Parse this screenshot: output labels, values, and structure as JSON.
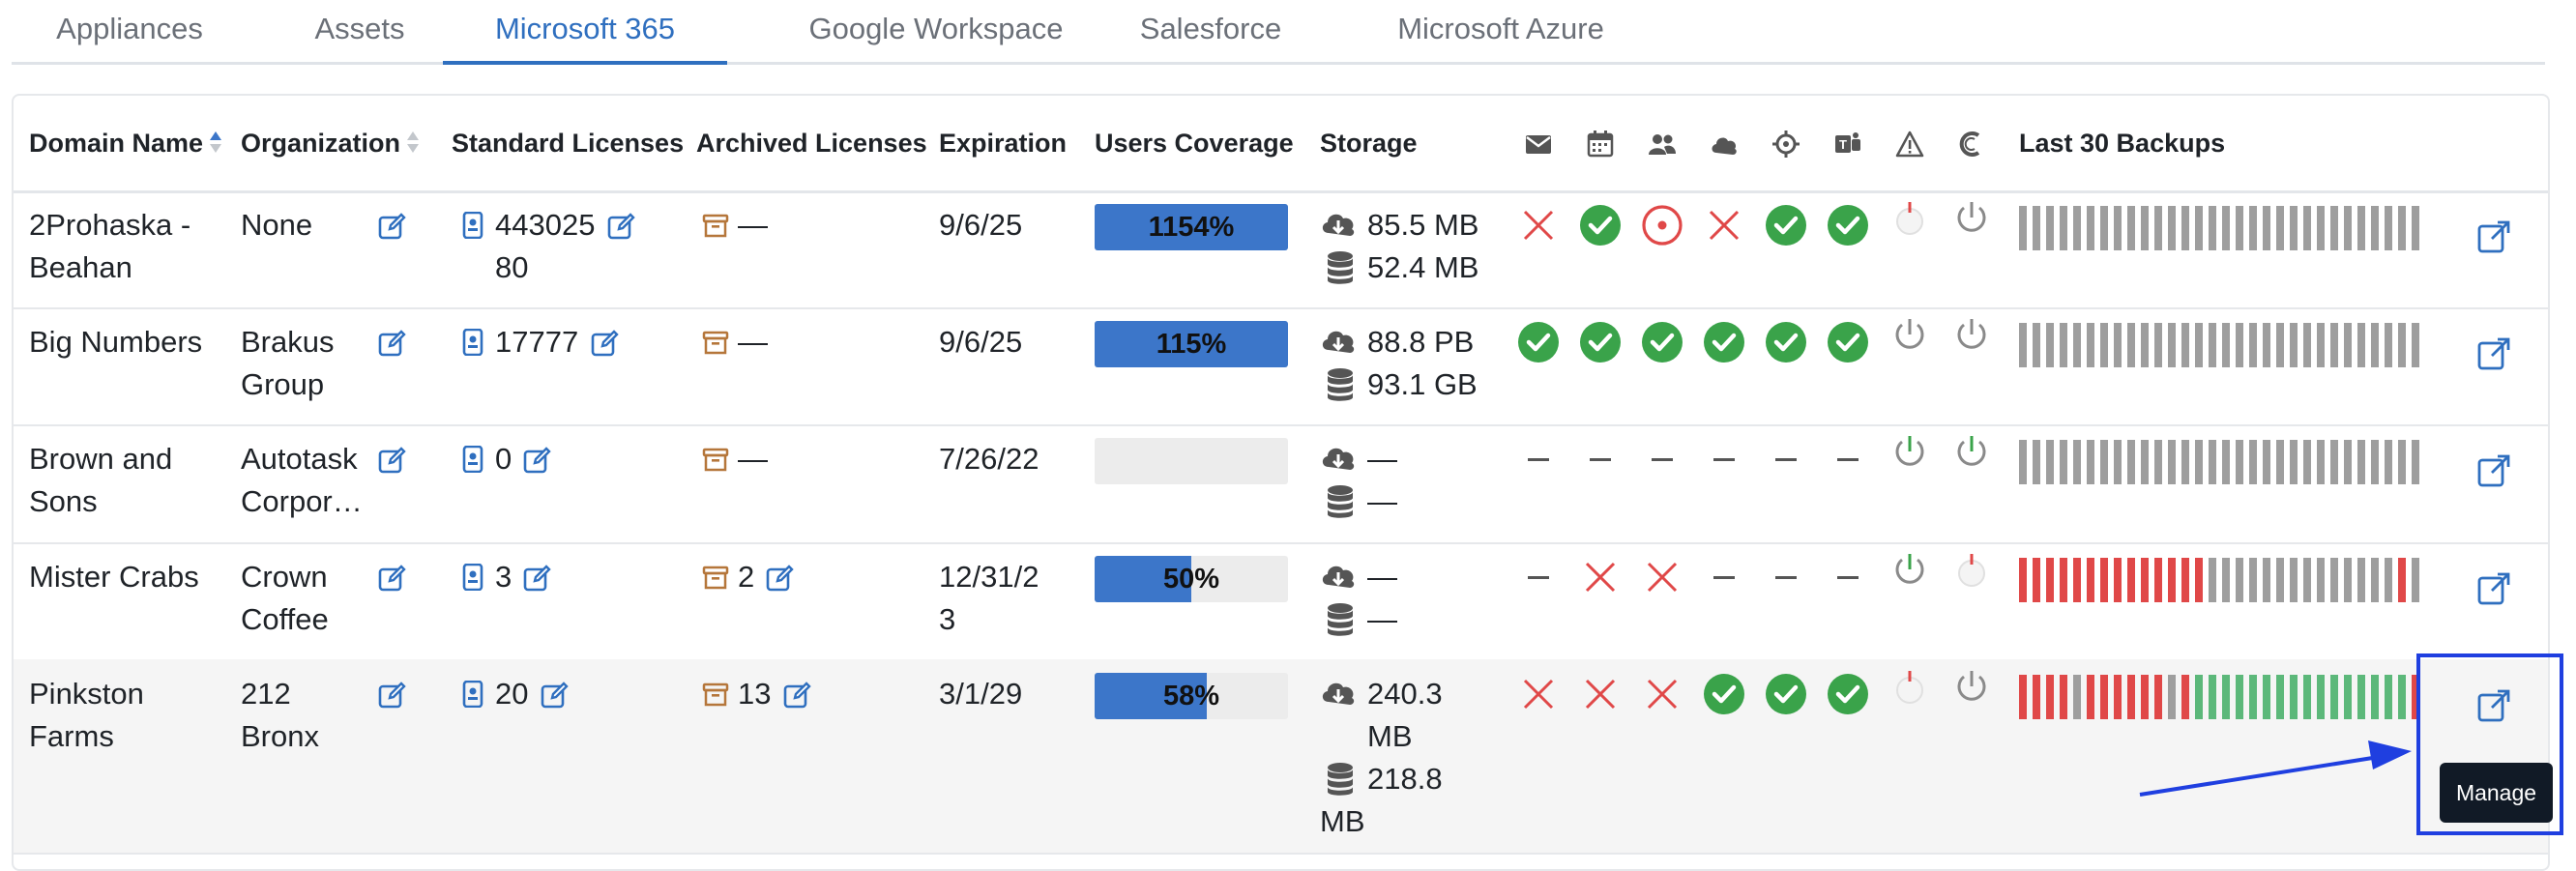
{
  "tabs": [
    "Appliances",
    "Assets",
    "Microsoft 365",
    "Google Workspace",
    "Salesforce",
    "Microsoft Azure"
  ],
  "active_tab": "Microsoft 365",
  "columns": {
    "domain": "Domain Name",
    "organization": "Organization",
    "standard": "Standard Licenses",
    "archived": "Archived Licenses",
    "expiration": "Expiration",
    "coverage": "Users Coverage",
    "storage": "Storage",
    "backups": "Last 30 Backups"
  },
  "service_icons": [
    "mail-icon",
    "calendar-icon",
    "contacts-icon",
    "onedrive-cloud-icon",
    "sharepoint-icon",
    "teams-icon",
    "alert-triangle-icon",
    "cloud-backup-icon"
  ],
  "rows": [
    {
      "domain": [
        "2Prohaska -",
        "Beahan"
      ],
      "org": [
        "None"
      ],
      "standard": [
        "443025",
        "80"
      ],
      "archived": "—",
      "expiration": [
        "9/6/25"
      ],
      "coverage_label": "1154%",
      "coverage": 1.0,
      "storage_down": [
        "85.5 MB"
      ],
      "storage_db": [
        "52.4 MB"
      ],
      "status": [
        "x",
        "ok",
        "target",
        "x",
        "ok",
        "ok",
        "knob-red",
        "power"
      ],
      "backups": "gray30"
    },
    {
      "domain": [
        "Big Numbers"
      ],
      "org": [
        "Brakus",
        "Group"
      ],
      "standard": [
        "17777"
      ],
      "archived": "—",
      "expiration": [
        "9/6/25"
      ],
      "coverage_label": "115%",
      "coverage": 1.0,
      "storage_down": [
        "88.8 PB"
      ],
      "storage_db": [
        "93.1 GB"
      ],
      "status": [
        "ok",
        "ok",
        "ok",
        "ok",
        "ok",
        "ok",
        "power",
        "power"
      ],
      "backups": "gray30"
    },
    {
      "domain": [
        "Brown and",
        "Sons"
      ],
      "org": [
        "Autotask",
        "Corpor…"
      ],
      "standard": [
        "0"
      ],
      "archived": "—",
      "expiration": [
        "7/26/22"
      ],
      "coverage_label": "",
      "coverage": 0.0,
      "storage_down": [
        "—"
      ],
      "storage_db": [
        "—"
      ],
      "status": [
        "dash",
        "dash",
        "dash",
        "dash",
        "dash",
        "dash",
        "power-green",
        "power-green"
      ],
      "backups": "gray30"
    },
    {
      "domain": [
        "Mister Crabs"
      ],
      "org": [
        "Crown",
        "Coffee"
      ],
      "standard": [
        "3"
      ],
      "archived": "2",
      "expiration": [
        "12/31/2",
        "3"
      ],
      "coverage_label": "50%",
      "coverage": 0.5,
      "storage_down": [
        "—"
      ],
      "storage_db": [
        "—"
      ],
      "status": [
        "dash",
        "x",
        "x",
        "dash",
        "dash",
        "dash",
        "power-green",
        "knob-red"
      ],
      "backups": "red-gray"
    },
    {
      "domain": [
        "Pinkston",
        "Farms"
      ],
      "org": [
        "212",
        "Bronx"
      ],
      "standard": [
        "20"
      ],
      "archived": "13",
      "expiration": [
        "3/1/29"
      ],
      "coverage_label": "58%",
      "coverage": 0.58,
      "storage_down": [
        "240.3",
        "MB"
      ],
      "storage_db": [
        "218.8",
        "MB"
      ],
      "status": [
        "x",
        "x",
        "x",
        "ok",
        "ok",
        "ok",
        "knob-red",
        "power"
      ],
      "backups": "red-green"
    }
  ],
  "colors": {
    "accent": "#2f6fbf",
    "ok": "#3aa34a",
    "error": "#e04848",
    "bar_fill": "#3c76c9",
    "backup_gray": "#9e9e9e",
    "backup_red": "#e04848",
    "backup_green": "#5cb87a"
  },
  "tooltip": "Manage"
}
